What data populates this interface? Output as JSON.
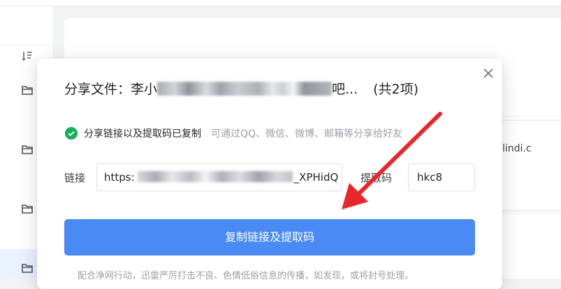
{
  "background": {
    "file_name_fragment": "lindi.c"
  },
  "dialog": {
    "title_prefix": "分享文件：李小",
    "title_suffix": "吧...",
    "item_count": "(共2项)",
    "status_text": "分享链接以及提取码已复制",
    "status_hint": "可通过QQ、微信、微博、邮箱等分享给好友",
    "link_label": "链接",
    "link_prefix": "https:",
    "link_suffix": "_XPHidQ",
    "code_label": "提取码",
    "code_value": "hkc8",
    "copy_button": "复制链接及提取码",
    "footer_note": "配合净网行动，迅雷严厉打击不良、色情低俗信息的传播，如发现，或将封号处理。"
  },
  "colors": {
    "accent": "#4a8af4",
    "success": "#1aad5b",
    "annotation_arrow": "#e8262b"
  },
  "icons": {
    "close": "close-icon",
    "success": "check-circle-icon",
    "folder": "folder-icon",
    "sort": "sort-icon",
    "annotation": "red-arrow"
  }
}
